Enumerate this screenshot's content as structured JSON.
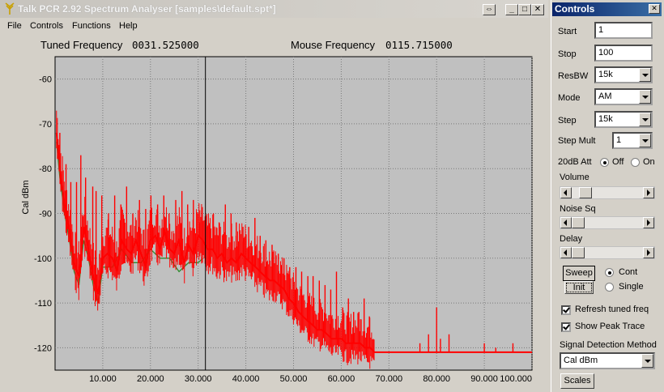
{
  "window": {
    "title": "Talk PCR 2.92 Spectrum Analyser [samples\\default.spt*]",
    "buttons": {
      "restore": "⇔",
      "minimize": "_",
      "maximize": "□",
      "close": "✕"
    }
  },
  "menu": {
    "items": [
      "File",
      "Controls",
      "Functions",
      "Help"
    ]
  },
  "readouts": {
    "tuned_label": "Tuned Frequency",
    "tuned_value": "0031.525000",
    "mouse_label": "Mouse Frequency",
    "mouse_value": "0115.715000"
  },
  "chart_data": {
    "type": "line",
    "ylabel": "Cal dBm",
    "xlabel": "",
    "xlim": [
      0,
      100
    ],
    "ylim": [
      -125,
      -55
    ],
    "grid": true,
    "x_ticks": [
      "10.000",
      "20.000",
      "30.000",
      "40.000",
      "50.000",
      "60.000",
      "70.000",
      "80.000",
      "90.000",
      "100.000"
    ],
    "y_ticks": [
      "-60",
      "-70",
      "-80",
      "-90",
      "-100",
      "-110",
      "-120"
    ],
    "y_tick_values": [
      -60,
      -70,
      -80,
      -90,
      -100,
      -110,
      -120
    ],
    "x_tick_values": [
      10,
      20,
      30,
      40,
      50,
      60,
      70,
      80,
      90,
      100
    ],
    "tuned_marker_x": 31.525,
    "series": [
      {
        "color": "#ff0000",
        "x": [
          0.3,
          1,
          2,
          3,
          4,
          5,
          6,
          7,
          8,
          9,
          10,
          11,
          12,
          13,
          14,
          15,
          16,
          17,
          18,
          19,
          20,
          21,
          22,
          23,
          24,
          25,
          26,
          27,
          28,
          29,
          30,
          31,
          32,
          33,
          34,
          35,
          36,
          37,
          38,
          39,
          40,
          41,
          42,
          43,
          44,
          45,
          46,
          47,
          48,
          49,
          50,
          51,
          52,
          53,
          54,
          55,
          56,
          57,
          58,
          59,
          60,
          61,
          62,
          63,
          64,
          65,
          66,
          67,
          68,
          70,
          72,
          75,
          78,
          80,
          82,
          85,
          88,
          90,
          92,
          95,
          98,
          100
        ],
        "values": [
          -72,
          -80,
          -88,
          -94,
          -101,
          -104,
          -93,
          -98,
          -104,
          -108,
          -100,
          -99,
          -100,
          -103,
          -96,
          -98,
          -99,
          -96,
          -99,
          -102,
          -96,
          -95,
          -98,
          -94,
          -98,
          -99,
          -96,
          -101,
          -97,
          -99,
          -95,
          -96,
          -98,
          -98,
          -100,
          -99,
          -101,
          -100,
          -101,
          -99,
          -100,
          -101,
          -102,
          -103,
          -104,
          -105,
          -105,
          -106,
          -107,
          -109,
          -110,
          -112,
          -113,
          -114,
          -115,
          -116,
          -116,
          -117,
          -118,
          -118,
          -118,
          -119,
          -119,
          -119,
          -119,
          -120,
          -120,
          -121,
          -121,
          -121,
          -121,
          -121,
          -121,
          -121,
          -121,
          -121,
          -121,
          -121,
          -121,
          -121,
          -121,
          -121
        ]
      },
      {
        "color": "#2e8b2e",
        "x": [
          0.3,
          1,
          2,
          3,
          4,
          5,
          6,
          7,
          8,
          9,
          10,
          12,
          14,
          16,
          18,
          20,
          22,
          24,
          26,
          28,
          30,
          31
        ],
        "values": [
          -74,
          -82,
          -90,
          -96,
          -103,
          -106,
          -96,
          -100,
          -106,
          -110,
          -102,
          -102,
          -98,
          -101,
          -101,
          -98,
          -100,
          -100,
          -103,
          -101,
          -101,
          -100
        ]
      }
    ],
    "spikes": [
      {
        "x": 1.0,
        "y": -72
      },
      {
        "x": 2.3,
        "y": -79
      },
      {
        "x": 3.3,
        "y": -83
      },
      {
        "x": 4.5,
        "y": -83
      },
      {
        "x": 5.4,
        "y": -77
      },
      {
        "x": 6.4,
        "y": -82
      },
      {
        "x": 7.9,
        "y": -84
      },
      {
        "x": 8.6,
        "y": -85
      },
      {
        "x": 9.8,
        "y": -86
      },
      {
        "x": 11.2,
        "y": -90
      },
      {
        "x": 12.5,
        "y": -86
      },
      {
        "x": 13.8,
        "y": -88
      },
      {
        "x": 15.0,
        "y": -84
      },
      {
        "x": 16.3,
        "y": -90
      },
      {
        "x": 17.7,
        "y": -87
      },
      {
        "x": 19.0,
        "y": -89
      },
      {
        "x": 20.1,
        "y": -86
      },
      {
        "x": 21.5,
        "y": -88
      },
      {
        "x": 22.8,
        "y": -86
      },
      {
        "x": 23.9,
        "y": -90
      },
      {
        "x": 25.3,
        "y": -87
      },
      {
        "x": 26.6,
        "y": -85
      },
      {
        "x": 27.8,
        "y": -88
      },
      {
        "x": 29.0,
        "y": -87
      },
      {
        "x": 30.3,
        "y": -92
      },
      {
        "x": 31.9,
        "y": -93
      },
      {
        "x": 33.2,
        "y": -90
      },
      {
        "x": 34.4,
        "y": -92
      },
      {
        "x": 35.7,
        "y": -88
      },
      {
        "x": 36.9,
        "y": -90
      },
      {
        "x": 38.0,
        "y": -92
      },
      {
        "x": 39.4,
        "y": -93
      },
      {
        "x": 40.6,
        "y": -93
      },
      {
        "x": 41.9,
        "y": -91
      },
      {
        "x": 43.0,
        "y": -95
      },
      {
        "x": 44.2,
        "y": -96
      },
      {
        "x": 45.5,
        "y": -97
      },
      {
        "x": 46.8,
        "y": -99
      },
      {
        "x": 48.0,
        "y": -100
      },
      {
        "x": 49.2,
        "y": -102
      },
      {
        "x": 50.5,
        "y": -102
      },
      {
        "x": 51.7,
        "y": -103
      },
      {
        "x": 53.0,
        "y": -104
      },
      {
        "x": 54.1,
        "y": -104
      },
      {
        "x": 55.4,
        "y": -105
      },
      {
        "x": 56.6,
        "y": -106
      },
      {
        "x": 57.8,
        "y": -107
      },
      {
        "x": 59.0,
        "y": -103
      },
      {
        "x": 60.3,
        "y": -111
      },
      {
        "x": 61.5,
        "y": -109
      },
      {
        "x": 62.6,
        "y": -112
      },
      {
        "x": 63.7,
        "y": -112
      },
      {
        "x": 64.8,
        "y": -109
      },
      {
        "x": 65.9,
        "y": -113
      },
      {
        "x": 76.5,
        "y": -119
      },
      {
        "x": 78.3,
        "y": -117
      },
      {
        "x": 80.0,
        "y": -111
      },
      {
        "x": 80.8,
        "y": -118
      },
      {
        "x": 82.6,
        "y": -117
      },
      {
        "x": 90.0,
        "y": -119
      },
      {
        "x": 92.4,
        "y": -120
      },
      {
        "x": 96.0,
        "y": -119
      }
    ]
  },
  "controls": {
    "title": "Controls",
    "close": "✕",
    "start_label": "Start",
    "start_value": "1",
    "stop_label": "Stop",
    "stop_value": "100",
    "resbw_label": "ResBW",
    "resbw_value": "15k",
    "mode_label": "Mode",
    "mode_value": "AM",
    "step_label": "Step",
    "step_value": "15k",
    "stepmult_label": "Step Mult",
    "stepmult_value": "1",
    "att_label": "20dB Att",
    "att_off": "Off",
    "att_on": "On",
    "att_selected": "Off",
    "volume_label": "Volume",
    "volume_level": 0.12,
    "noise_label": "Noise Sq",
    "noise_level": 0.0,
    "delay_label": "Delay",
    "delay_level": 0.0,
    "sweep_button": "Sweep",
    "init_button": "Init",
    "cont_label": "Cont",
    "single_label": "Single",
    "sweep_mode": "Cont",
    "refresh_label": "Refresh tuned freq",
    "refresh_checked": true,
    "peak_label": "Show Peak Trace",
    "peak_checked": true,
    "detect_label": "Signal Detection Method",
    "detect_value": "Cal dBm",
    "scales_button": "Scales"
  }
}
